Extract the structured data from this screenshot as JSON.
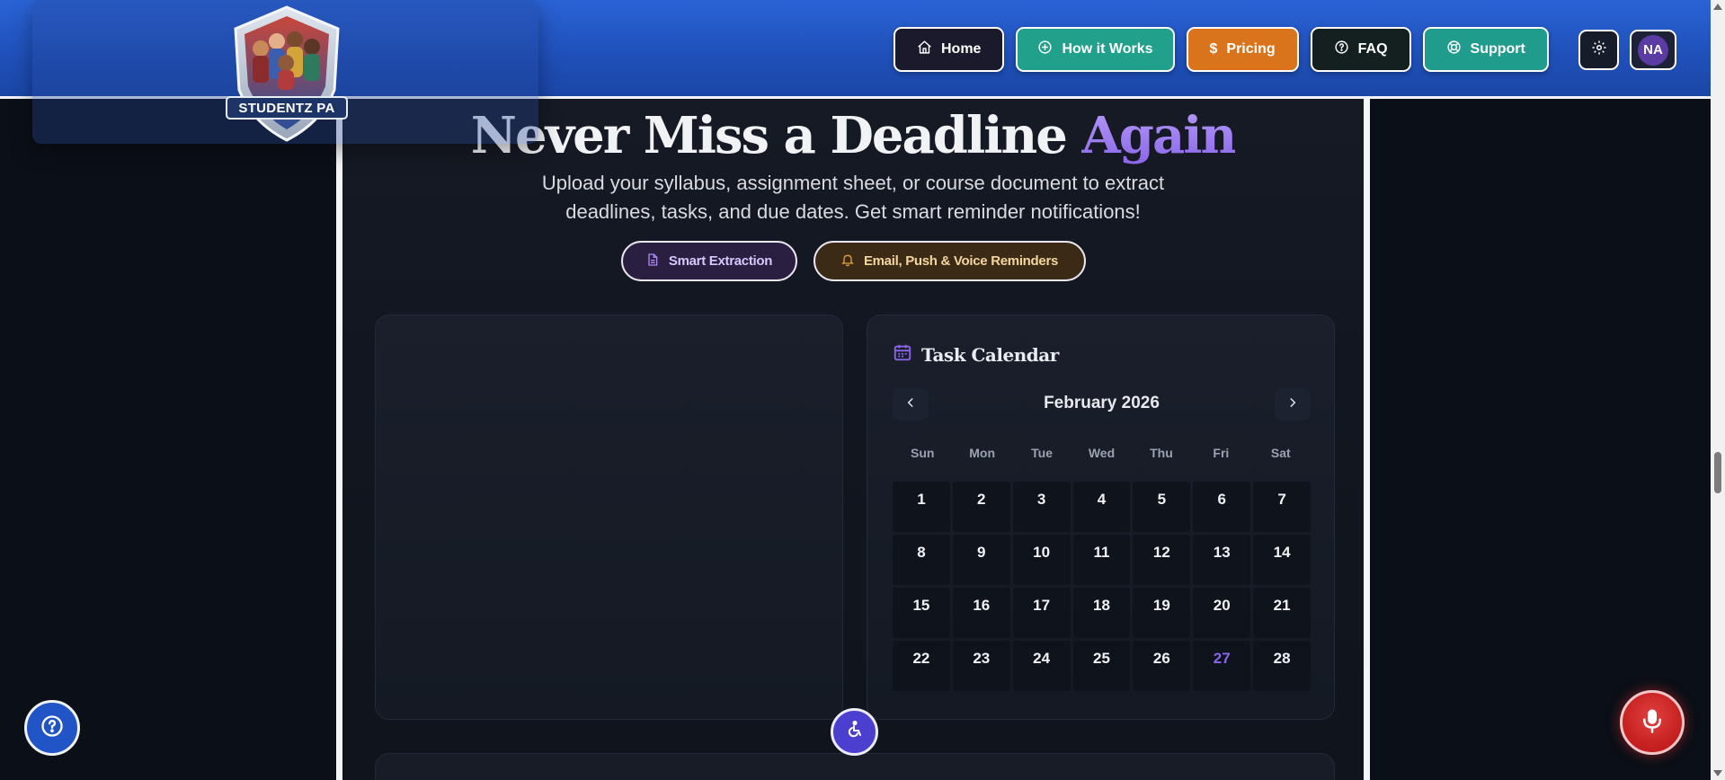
{
  "brand": {
    "logo_text": "STUDENTZ PA"
  },
  "nav": {
    "home": "Home",
    "how": "How it Works",
    "pricing": "Pricing",
    "faq": "FAQ",
    "support": "Support"
  },
  "user": {
    "initials": "NA"
  },
  "hero": {
    "title_main": "Never Miss a Deadline ",
    "title_accent": "Again",
    "subtitle": "Upload your syllabus, assignment sheet, or course document to extract deadlines, tasks, and due dates. Get smart reminder notifications!"
  },
  "features": {
    "extraction": "Smart Extraction",
    "reminders": "Email, Push & Voice Reminders"
  },
  "calendar": {
    "title": "Task Calendar",
    "month_label": "February 2026",
    "weekdays": [
      "Sun",
      "Mon",
      "Tue",
      "Wed",
      "Thu",
      "Fri",
      "Sat"
    ],
    "days": [
      "1",
      "2",
      "3",
      "4",
      "5",
      "6",
      "7",
      "8",
      "9",
      "10",
      "11",
      "12",
      "13",
      "14",
      "15",
      "16",
      "17",
      "18",
      "19",
      "20",
      "21",
      "22",
      "23",
      "24",
      "25",
      "26",
      "27",
      "28"
    ],
    "highlighted_day": "27"
  },
  "colors": {
    "header_blue": "#2a63d6",
    "accent_purple": "#8b66ea",
    "how_teal": "#21a08c",
    "pricing_orange": "#d9741c",
    "mic_red": "#c41e1e"
  },
  "icons": {
    "home": "home-icon",
    "how": "plus-circle-icon",
    "pricing": "dollar-icon",
    "faq": "question-circle-icon",
    "support": "lifebuoy-icon",
    "settings": "gear-icon",
    "calendar": "calendar-icon",
    "help": "help-icon",
    "accessibility": "accessibility-icon",
    "mic": "microphone-icon"
  }
}
